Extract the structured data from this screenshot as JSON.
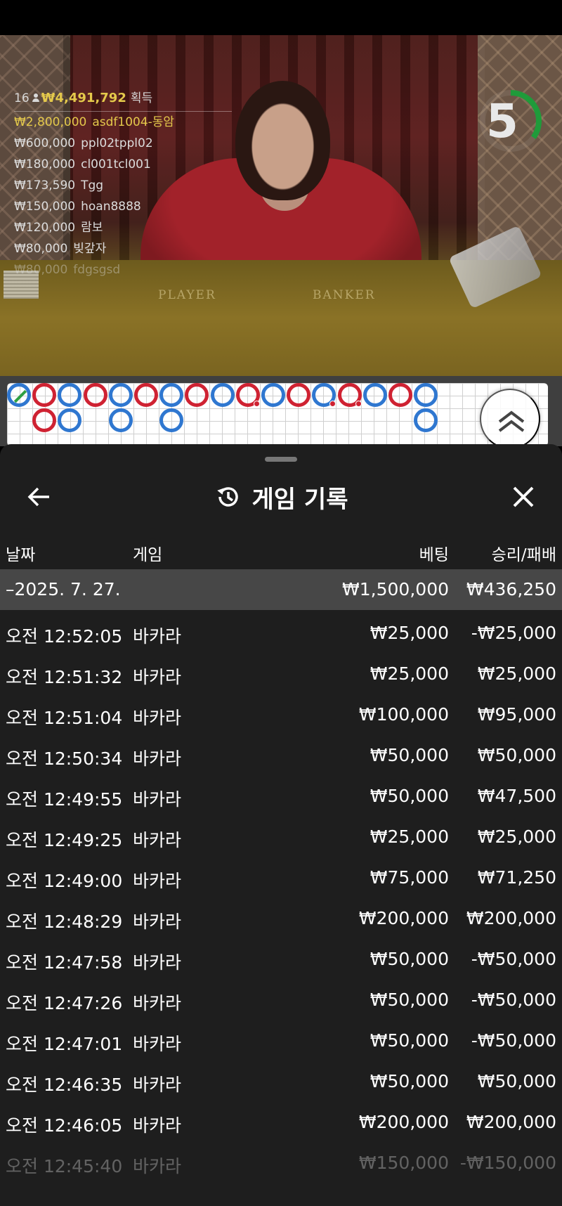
{
  "video": {
    "table_labels": [
      "PLAYER",
      "BANKER"
    ],
    "timer": "5",
    "timer_progress": 0.35
  },
  "winners": {
    "count": "16",
    "total": "₩4,491,792",
    "total_suffix": "획득",
    "list": [
      {
        "amount": "₩2,800,000",
        "name": "asdf1004-동암"
      },
      {
        "amount": "₩600,000",
        "name": "ppl02tppl02"
      },
      {
        "amount": "₩180,000",
        "name": "cl001tcl001"
      },
      {
        "amount": "₩173,590",
        "name": "Tgg"
      },
      {
        "amount": "₩150,000",
        "name": "hoan8888"
      },
      {
        "amount": "₩120,000",
        "name": "람보"
      },
      {
        "amount": "₩80,000",
        "name": "빚갚자"
      },
      {
        "amount": "₩80,000",
        "name": "fdgsgsd"
      }
    ]
  },
  "road": {
    "colors": {
      "player": "#2f77d0",
      "banker": "#cf2232",
      "tie": "#2ea043"
    },
    "row1": [
      "p-tie",
      "b",
      "p",
      "b",
      "p",
      "b",
      "p",
      "b",
      "p",
      "b-pair",
      "p",
      "b",
      "p-pair",
      "b-pair",
      "p",
      "b",
      "p"
    ],
    "row2": {
      "1": "b",
      "2": "p",
      "4": "p",
      "6": "p",
      "16": "p"
    }
  },
  "sheet": {
    "title": "게임 기록",
    "columns": {
      "date": "날짜",
      "game": "게임",
      "bet": "베팅",
      "winloss": "승리/패배"
    },
    "summary": {
      "date": "–2025. 7. 27.",
      "bet": "₩1,500,000",
      "winloss": "₩436,250"
    },
    "rows": [
      {
        "time": "오전 12:52:05",
        "game": "바카라",
        "bet": "₩25,000",
        "winloss": "-₩25,000"
      },
      {
        "time": "오전 12:51:32",
        "game": "바카라",
        "bet": "₩25,000",
        "winloss": "₩25,000"
      },
      {
        "time": "오전 12:51:04",
        "game": "바카라",
        "bet": "₩100,000",
        "winloss": "₩95,000"
      },
      {
        "time": "오전 12:50:34",
        "game": "바카라",
        "bet": "₩50,000",
        "winloss": "₩50,000"
      },
      {
        "time": "오전 12:49:55",
        "game": "바카라",
        "bet": "₩50,000",
        "winloss": "₩47,500"
      },
      {
        "time": "오전 12:49:25",
        "game": "바카라",
        "bet": "₩25,000",
        "winloss": "₩25,000"
      },
      {
        "time": "오전 12:49:00",
        "game": "바카라",
        "bet": "₩75,000",
        "winloss": "₩71,250"
      },
      {
        "time": "오전 12:48:29",
        "game": "바카라",
        "bet": "₩200,000",
        "winloss": "₩200,000"
      },
      {
        "time": "오전 12:47:58",
        "game": "바카라",
        "bet": "₩50,000",
        "winloss": "-₩50,000"
      },
      {
        "time": "오전 12:47:26",
        "game": "바카라",
        "bet": "₩50,000",
        "winloss": "-₩50,000"
      },
      {
        "time": "오전 12:47:01",
        "game": "바카라",
        "bet": "₩50,000",
        "winloss": "-₩50,000"
      },
      {
        "time": "오전 12:46:35",
        "game": "바카라",
        "bet": "₩50,000",
        "winloss": "₩50,000"
      },
      {
        "time": "오전 12:46:05",
        "game": "바카라",
        "bet": "₩200,000",
        "winloss": "₩200,000"
      },
      {
        "time": "오전 12:45:40",
        "game": "바카라",
        "bet": "₩150,000",
        "winloss": "-₩150,000"
      }
    ]
  },
  "icons": {
    "back": "arrow-left-icon",
    "history": "history-icon",
    "close": "close-icon",
    "scroll_top": "double-chevron-up-icon"
  }
}
